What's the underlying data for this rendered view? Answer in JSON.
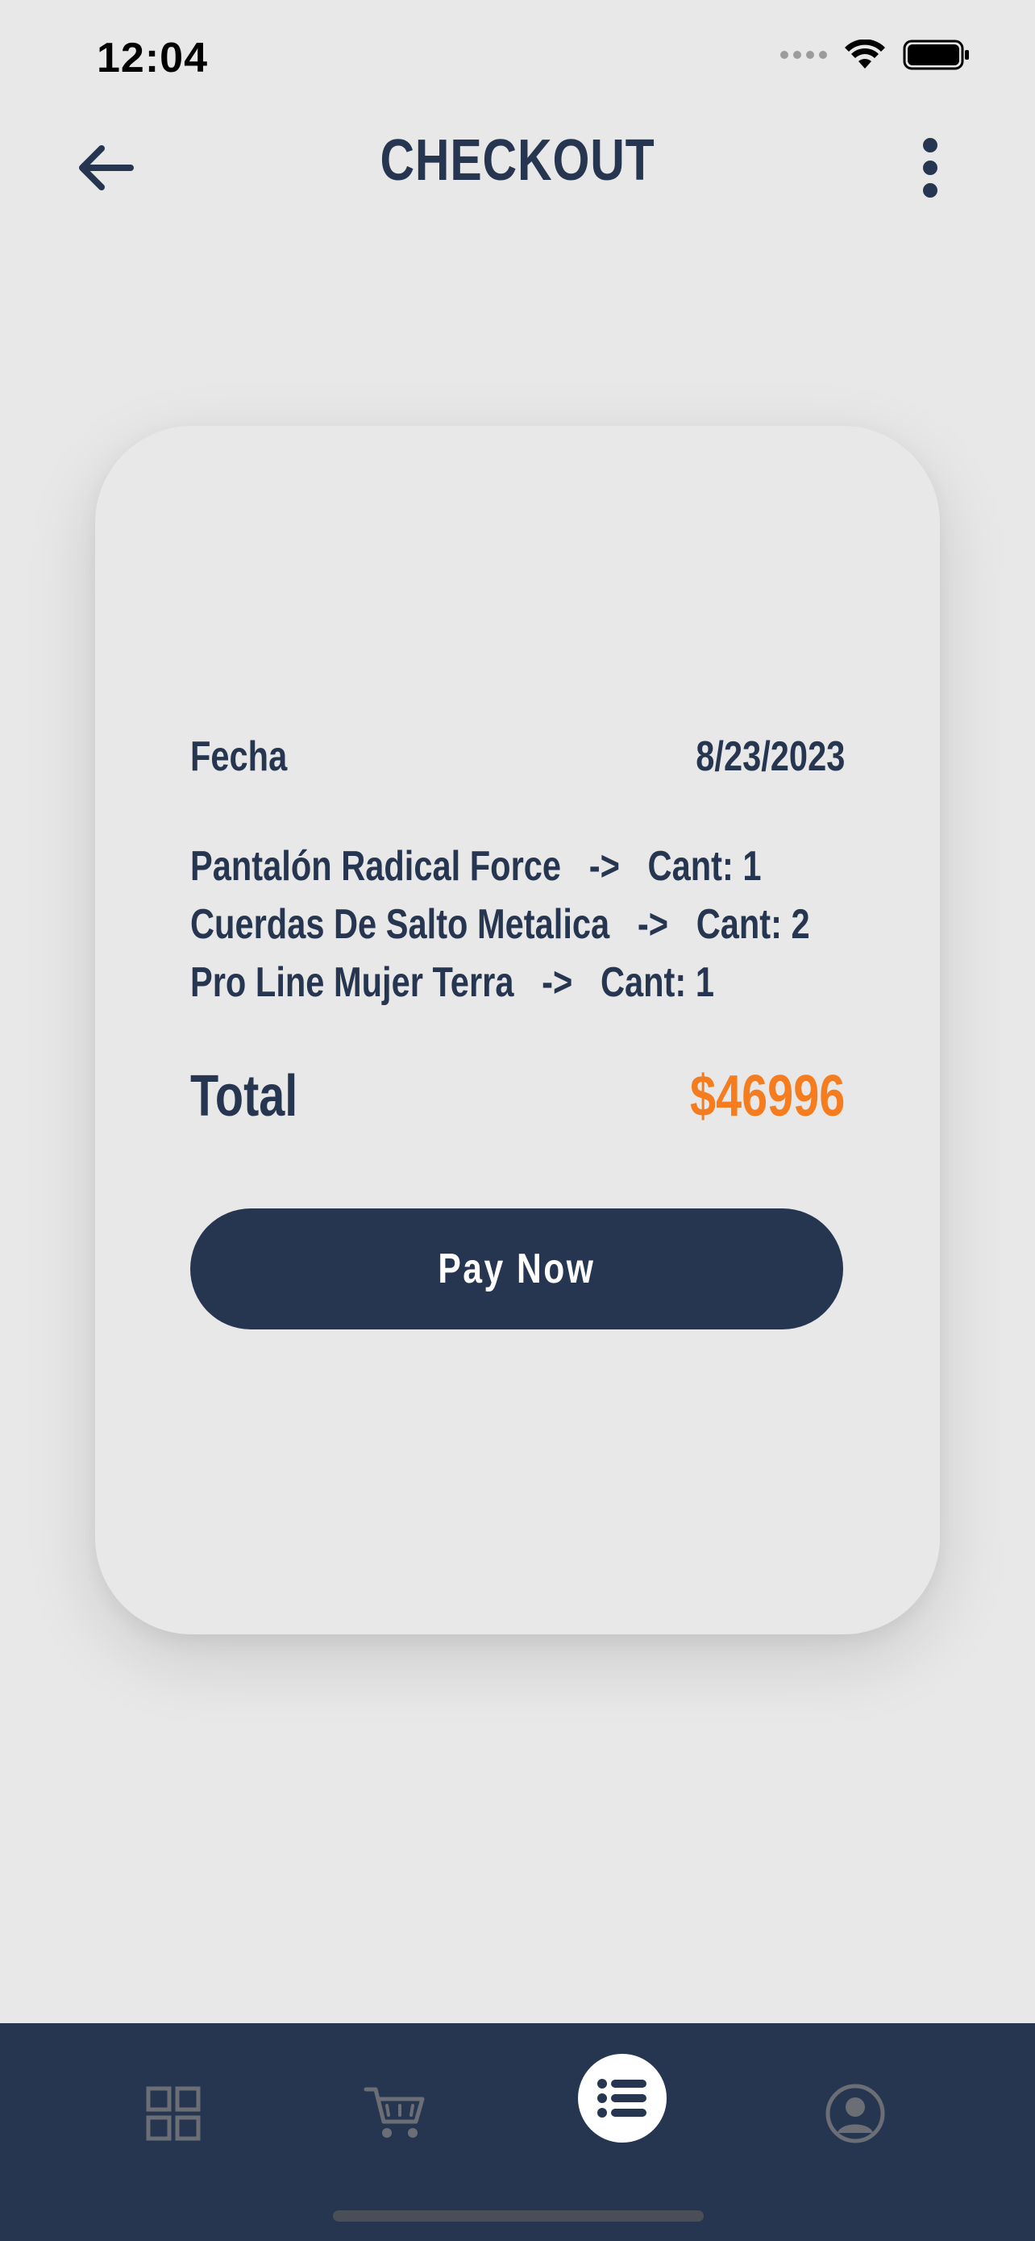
{
  "status_bar": {
    "time": "12:04"
  },
  "header": {
    "title": "CHECKOUT"
  },
  "receipt": {
    "date_label": "Fecha",
    "date_value": "8/23/2023",
    "items": [
      {
        "name": "Pantalón Radical Force",
        "arrow": "->",
        "qty": "Cant: 1"
      },
      {
        "name": "Cuerdas De Salto Metalica",
        "arrow": "->",
        "qty": "Cant: 2"
      },
      {
        "name": "Pro Line Mujer Terra",
        "arrow": "->",
        "qty": "Cant: 1"
      }
    ],
    "total_label": "Total",
    "total_value": "$46996",
    "pay_button_label": "Pay Now"
  },
  "bottom_nav": {
    "items": [
      {
        "icon": "grid-icon",
        "active": false
      },
      {
        "icon": "cart-icon",
        "active": false
      },
      {
        "icon": "list-icon",
        "active": true
      },
      {
        "icon": "user-icon",
        "active": false
      }
    ]
  },
  "colors": {
    "primary": "#273650",
    "accent": "#f57c1f",
    "background": "#e8e8e8",
    "inactive_icon": "#6b6f75"
  }
}
